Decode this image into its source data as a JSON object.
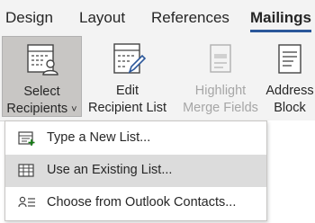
{
  "tabs": [
    {
      "label": "Design"
    },
    {
      "label": "Layout"
    },
    {
      "label": "References"
    },
    {
      "label": "Mailings"
    }
  ],
  "ribbon": {
    "select_recipients": {
      "line1": "Select",
      "line2": "Recipients",
      "chevron": "˅"
    },
    "edit_recipient_list": {
      "line1": "Edit",
      "line2": "Recipient List"
    },
    "highlight_merge_fields": {
      "line1": "Highlight",
      "line2": "Merge Fields"
    },
    "address_block": {
      "line1": "Address",
      "line2": "Block"
    }
  },
  "menu": {
    "items": [
      {
        "label": "Type a New List...",
        "icon": "new-list-icon"
      },
      {
        "label": "Use an Existing List...",
        "icon": "existing-list-icon"
      },
      {
        "label": "Choose from Outlook Contacts...",
        "icon": "outlook-contacts-icon"
      }
    ]
  },
  "colors": {
    "accent": "#2b579a",
    "green_plus": "#107c10",
    "pressed_bg": "#c8c6c4",
    "hover_bg": "#dcdcdc"
  }
}
